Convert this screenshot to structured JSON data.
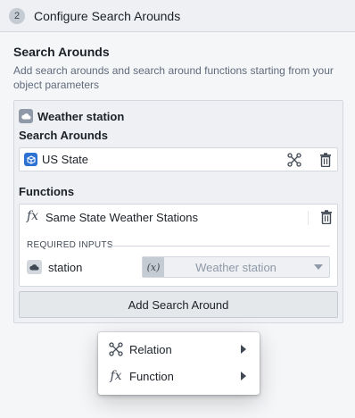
{
  "step": {
    "number": "2",
    "title": "Configure Search Arounds"
  },
  "section": {
    "title": "Search Arounds",
    "description": "Add search arounds and search around functions starting from your object parameters"
  },
  "card": {
    "object_name": "Weather station",
    "search_arounds_label": "Search Arounds",
    "search_around_item": "US State",
    "functions_label": "Functions",
    "function_name": "Same State Weather Stations",
    "required_inputs_label": "REQUIRED INPUTS",
    "input_name": "station",
    "input_fx": "(x)",
    "input_value": "Weather station",
    "add_button_label": "Add Search Around"
  },
  "menu": {
    "items": [
      {
        "label": "Relation",
        "icon": "relation-icon"
      },
      {
        "label": "Function",
        "icon": "function-icon"
      }
    ]
  },
  "colors": {
    "accent": "#2d72d2",
    "muted": "#8f99a8"
  }
}
